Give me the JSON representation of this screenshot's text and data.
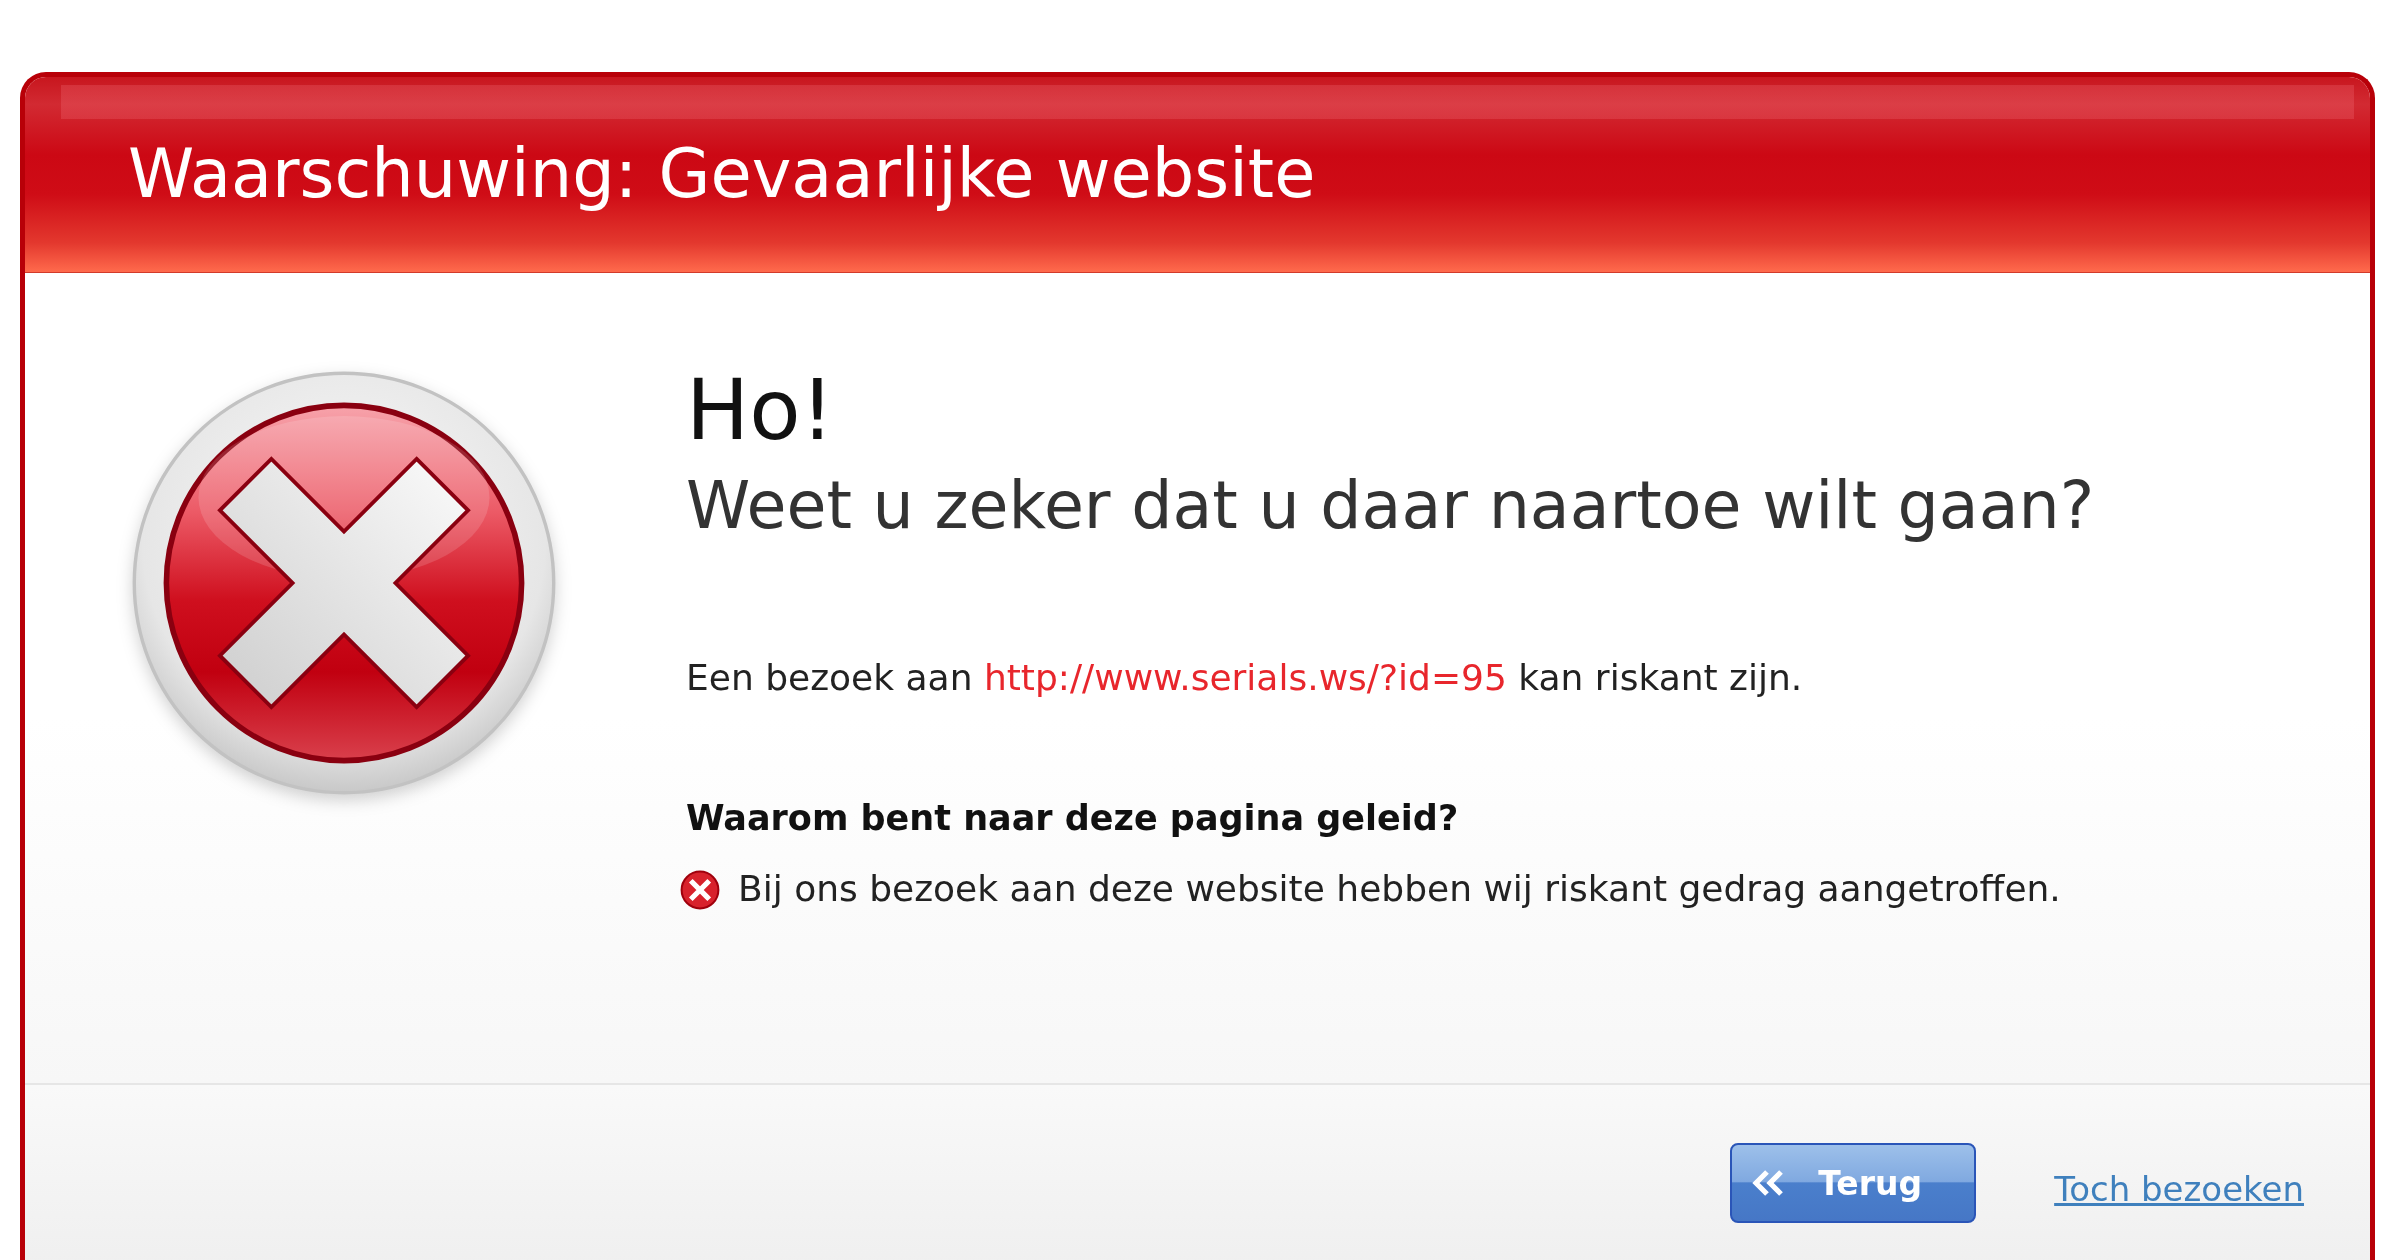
{
  "header": {
    "title": "Waarschuwing: Gevaarlijke website"
  },
  "message": {
    "exclamation": "Ho!",
    "question": "Weet u zeker dat u daar naartoe wilt gaan?",
    "risk_sentence": {
      "before": "Een bezoek aan",
      "url": "http://www.serials.ws/?id=95",
      "after": "kan riskant zijn."
    }
  },
  "reasons": {
    "heading": "Waarom bent naar deze pagina geleid?",
    "items": [
      {
        "text": "Bij ons bezoek aan deze website hebben wij riskant gedrag aangetroffen."
      }
    ]
  },
  "actions": [
    {
      "kind": "button",
      "label": "Terug"
    },
    {
      "kind": "link",
      "label": "Toch bezoeken"
    }
  ]
}
